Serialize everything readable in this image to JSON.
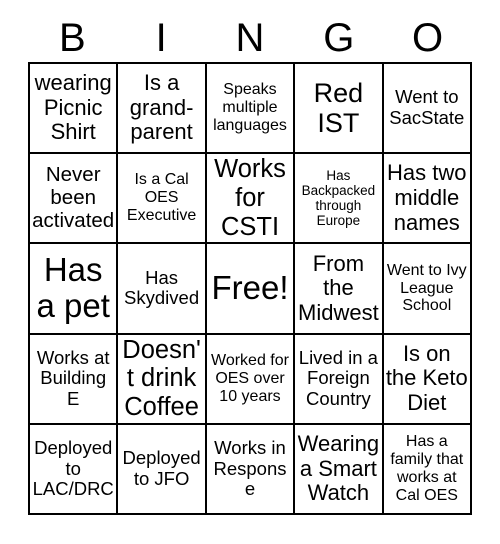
{
  "card": {
    "title": "BINGO",
    "header_letters": [
      "B",
      "I",
      "N",
      "G",
      "O"
    ],
    "columns": 5,
    "rows": 5,
    "border_color": "#000000",
    "background_color": "#ffffff",
    "text_color": "#000000",
    "cells": [
      {
        "text": "wearing Picnic Shirt",
        "size": "lg",
        "free": false
      },
      {
        "text": "Is a grand-parent",
        "size": "lg",
        "free": false
      },
      {
        "text": "Speaks multiple languages",
        "size": "sm",
        "free": false
      },
      {
        "text": "Red IST",
        "size": "xl",
        "free": false
      },
      {
        "text": "Went to SacState",
        "size": "md",
        "free": false
      },
      {
        "text": "Never been activated",
        "size": "lg",
        "free": false
      },
      {
        "text": "Is a Cal OES Executive",
        "size": "sm",
        "free": false
      },
      {
        "text": "Works for CSTI",
        "size": "xl",
        "free": false
      },
      {
        "text": "Has Backpacked through Europe",
        "size": "xs",
        "free": false
      },
      {
        "text": "Has two middle names",
        "size": "lg",
        "free": false
      },
      {
        "text": "Has a pet",
        "size": "xxl",
        "free": false
      },
      {
        "text": "Has Skydived",
        "size": "md",
        "free": false
      },
      {
        "text": "Free!",
        "size": "xxl",
        "free": true
      },
      {
        "text": "From the Midwest",
        "size": "lg",
        "free": false
      },
      {
        "text": "Went to Ivy League School",
        "size": "sm",
        "free": false
      },
      {
        "text": "Works at Building E",
        "size": "md",
        "free": false
      },
      {
        "text": "Doesn't drink Coffee",
        "size": "xl",
        "free": false
      },
      {
        "text": "Worked for OES over 10 years",
        "size": "sm",
        "free": false
      },
      {
        "text": "Lived in a Foreign Country",
        "size": "md",
        "free": false
      },
      {
        "text": "Is on the Keto Diet",
        "size": "lg",
        "free": false
      },
      {
        "text": "Deployed to LAC/DRC",
        "size": "md",
        "free": false
      },
      {
        "text": "Deployed to JFO",
        "size": "md",
        "free": false
      },
      {
        "text": "Works in Response",
        "size": "md",
        "free": false
      },
      {
        "text": "Wearing a Smart Watch",
        "size": "lg",
        "free": false
      },
      {
        "text": "Has a family that works at Cal OES",
        "size": "sm",
        "free": false
      }
    ]
  }
}
